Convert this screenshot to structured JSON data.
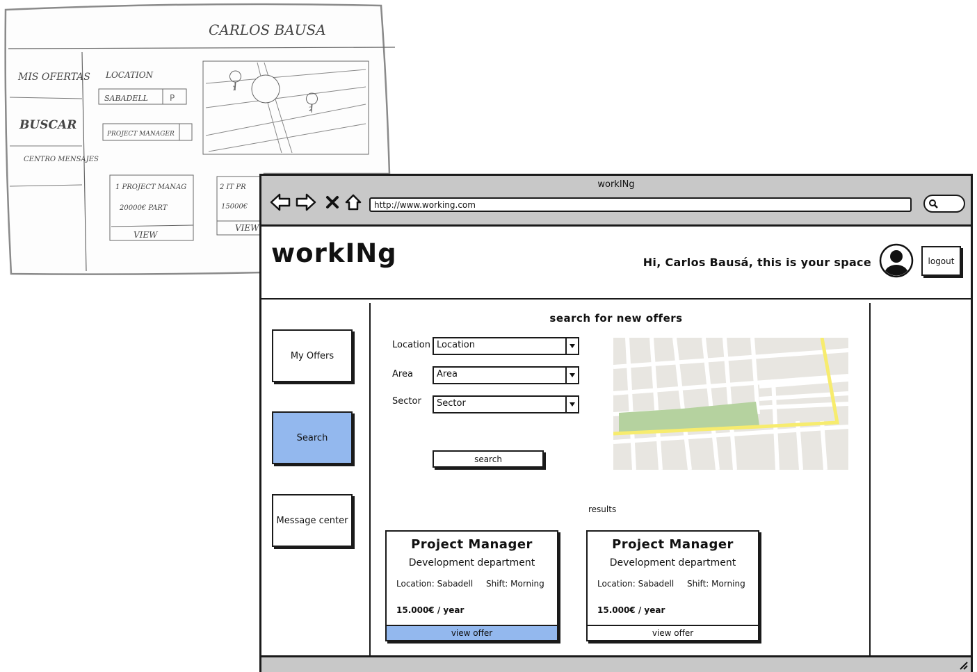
{
  "sketch": {
    "name": "CARLOS BAUSA",
    "menu": [
      "MIS OFERTAS",
      "BUSCAR",
      "CENTRO MENSAJES"
    ],
    "location_label": "LOCATION",
    "location_value": "SABADELL",
    "position_value": "PROJECT MANAGER",
    "cards": [
      {
        "line1": "1 PROJECT MANAG",
        "line2": "20000€ PART",
        "btn": "VIEW"
      },
      {
        "line1": "2 IT PR",
        "line2": "15000€",
        "btn": "VIEW"
      }
    ],
    "map_pins": [
      "1",
      "2"
    ]
  },
  "window": {
    "title": "workINg",
    "url": "http://www.working.com"
  },
  "header": {
    "logo": "workINg",
    "greeting": "Hi, Carlos Bausá, this is your space",
    "logout": "logout"
  },
  "sidebar": {
    "items": [
      {
        "label": "My Offers",
        "active": false
      },
      {
        "label": "Search",
        "active": true
      },
      {
        "label": "Message center",
        "active": false
      }
    ]
  },
  "search": {
    "heading": "search for new offers",
    "fields": [
      {
        "label": "Location",
        "value": "Location"
      },
      {
        "label": "Area",
        "value": "Area"
      },
      {
        "label": "Sector",
        "value": "Sector"
      }
    ],
    "button": "search"
  },
  "results": {
    "label": "results",
    "cards": [
      {
        "title": "Project Manager",
        "department": "Development department",
        "location": "Location: Sabadell",
        "shift": "Shift: Morning",
        "salary": "15.000€ / year",
        "button": "view offer",
        "highlighted": true
      },
      {
        "title": "Project Manager",
        "department": "Development department",
        "location": "Location: Sabadell",
        "shift": "Shift: Morning",
        "salary": "15.000€ / year",
        "button": "view offer",
        "highlighted": false
      }
    ]
  },
  "colors": {
    "accent": "#93b8ee",
    "map_road": "#ffffff",
    "map_park": "#b5d29f",
    "map_highlight": "#f7ec6e",
    "map_bg": "#e8e6e1"
  }
}
